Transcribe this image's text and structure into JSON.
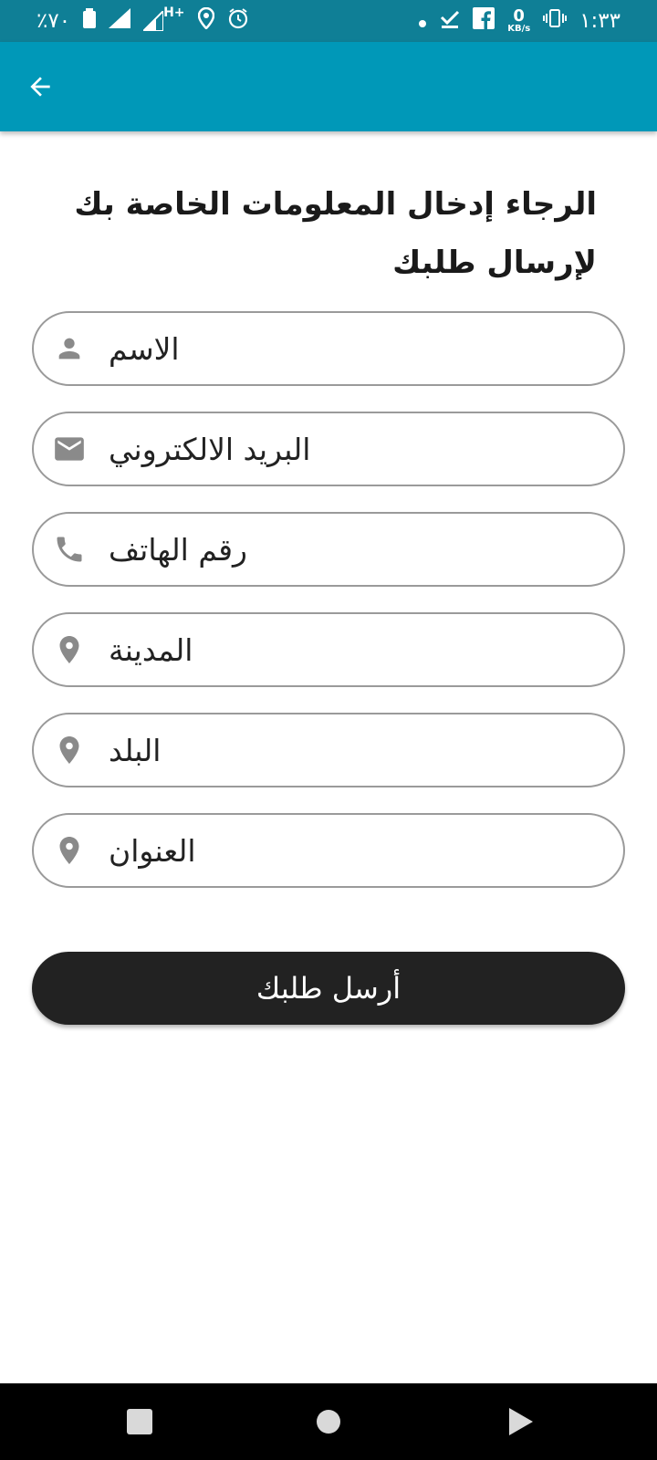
{
  "status_bar": {
    "time": "١:٣٣",
    "net_speed_value": "0",
    "net_speed_unit": "KB/s",
    "network_type": "H+",
    "battery": "٪٧٠"
  },
  "app_bar": {
    "back_icon": "arrow-left-icon"
  },
  "form": {
    "heading": "الرجاء إدخال المعلومات الخاصة بك لإرسال طلبك",
    "fields": [
      {
        "placeholder": "الاسم",
        "icon": "person-icon"
      },
      {
        "placeholder": "البريد الالكتروني",
        "icon": "email-icon"
      },
      {
        "placeholder": "رقم الهاتف",
        "icon": "phone-icon"
      },
      {
        "placeholder": "المدينة",
        "icon": "location-pin-icon"
      },
      {
        "placeholder": "البلد",
        "icon": "location-pin-icon"
      },
      {
        "placeholder": "العنوان",
        "icon": "location-pin-icon"
      }
    ],
    "submit_label": "أرسل طلبك"
  },
  "colors": {
    "status_bar": "#0f7f96",
    "app_bar": "#0098b8",
    "button": "#222222",
    "icon": "#8a8a8a"
  }
}
